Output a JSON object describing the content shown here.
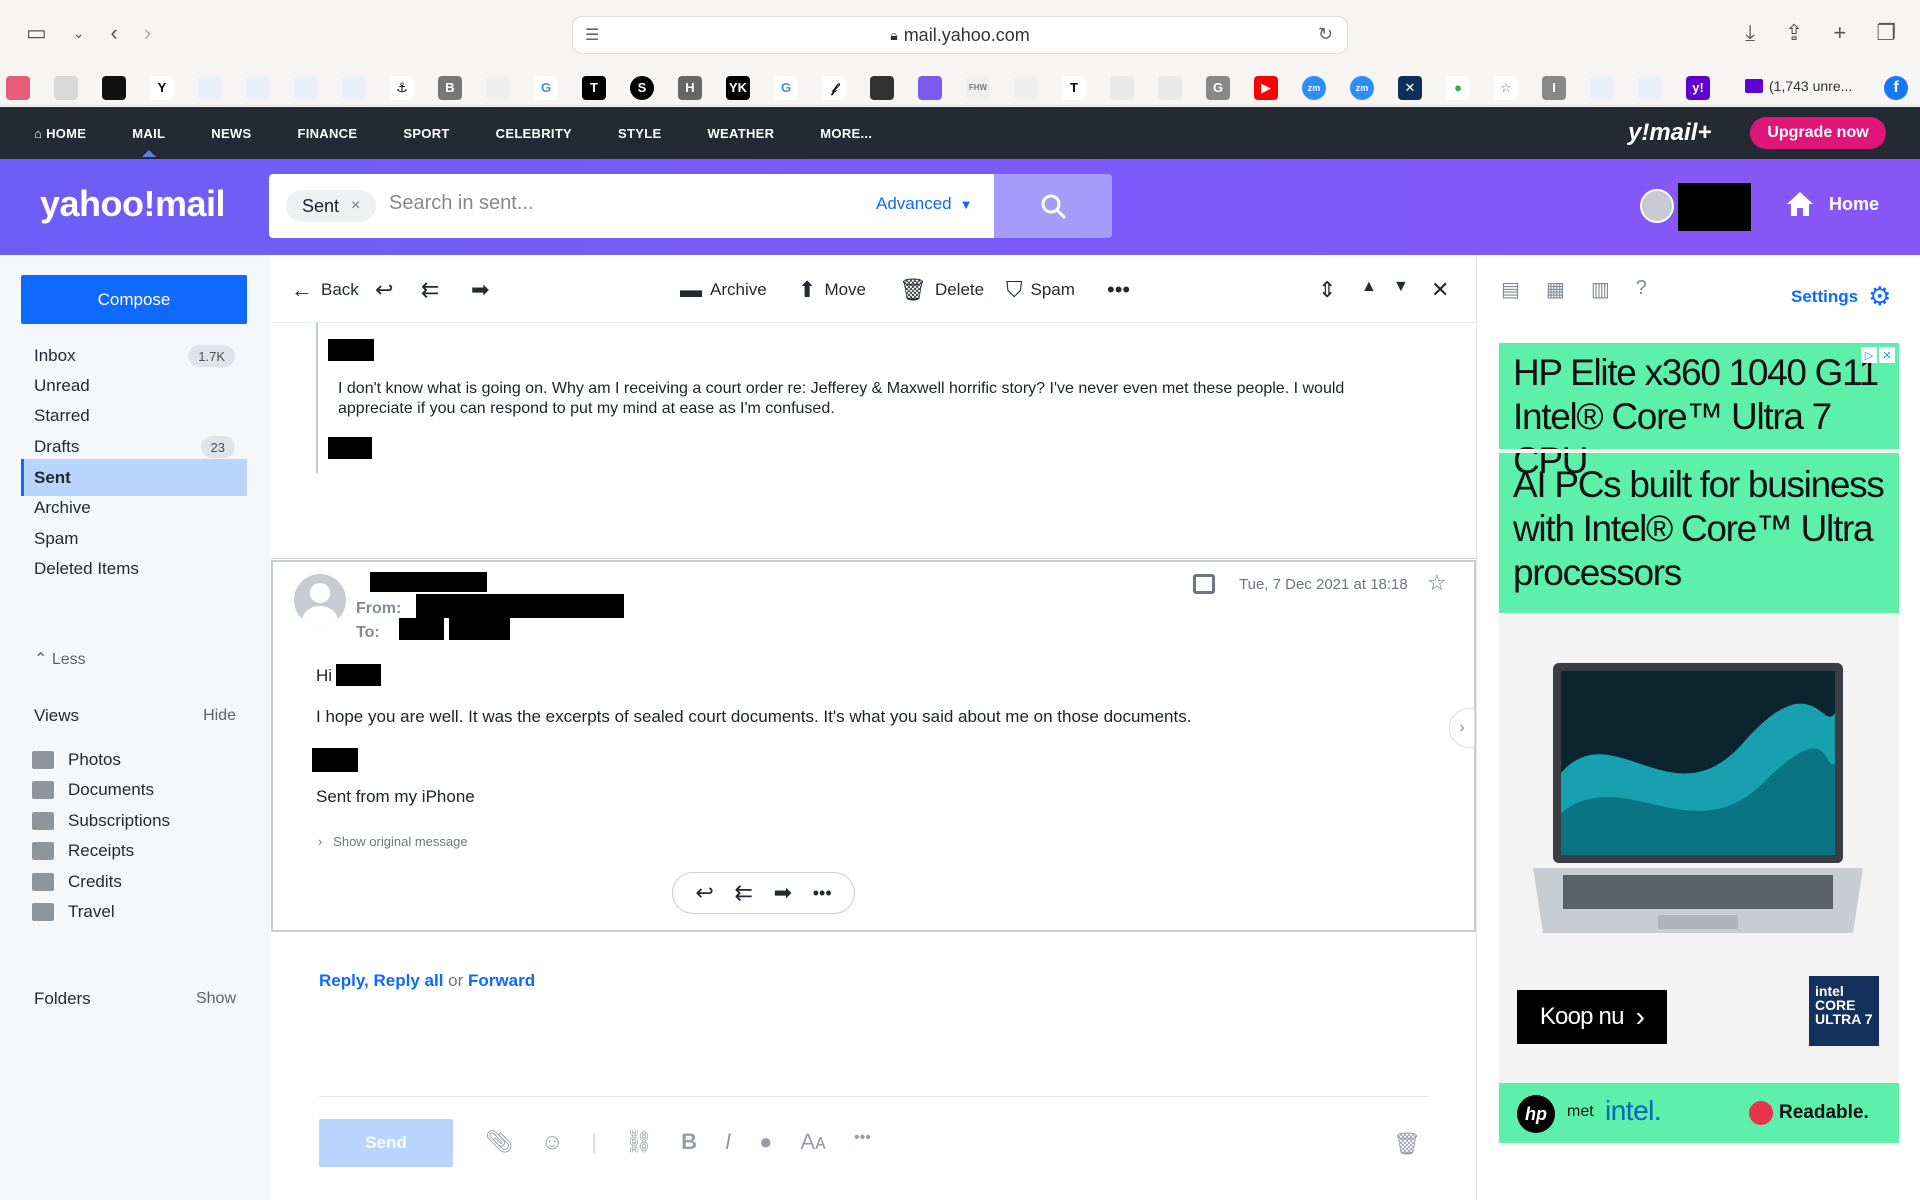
{
  "browser": {
    "url": "mail.yahoo.com",
    "mail_tab": "(1,743 unre..."
  },
  "nav": {
    "items": [
      "HOME",
      "MAIL",
      "NEWS",
      "FINANCE",
      "SPORT",
      "CELEBRITY",
      "STYLE",
      "WEATHER",
      "MORE..."
    ],
    "brand": "y!mail+",
    "upgrade": "Upgrade now"
  },
  "header": {
    "logo": "yahoo!mail",
    "chip": "Sent",
    "search_placeholder": "Search in sent...",
    "advanced": "Advanced",
    "home": "Home"
  },
  "sidebar": {
    "compose": "Compose",
    "folders": [
      {
        "label": "Inbox",
        "count": "1.7K"
      },
      {
        "label": "Unread",
        "count": ""
      },
      {
        "label": "Starred",
        "count": ""
      },
      {
        "label": "Drafts",
        "count": "23"
      },
      {
        "label": "Sent",
        "count": ""
      },
      {
        "label": "Archive",
        "count": ""
      },
      {
        "label": "Spam",
        "count": ""
      },
      {
        "label": "Deleted Items",
        "count": ""
      }
    ],
    "less": "Less",
    "views_title": "Views",
    "views_toggle": "Hide",
    "views": [
      "Photos",
      "Documents",
      "Subscriptions",
      "Receipts",
      "Credits",
      "Travel"
    ],
    "folders_title": "Folders",
    "folders_toggle": "Show"
  },
  "toolbar": {
    "back": "Back",
    "archive": "Archive",
    "move": "Move",
    "delete": "Delete",
    "spam": "Spam"
  },
  "thread": {
    "quoted_text": "I don't know what is going on. Why am I receiving a court order re: Jefferey & Maxwell horrific story? I've never even met these people. I would appreciate if you can respond to put my mind at ease as I'm confused.",
    "message": {
      "from_label": "From:",
      "to_label": "To:",
      "date": "Tue, 7 Dec 2021 at 18:18",
      "greeting": "Hi",
      "body": "I hope you are well. It was the excerpts of sealed court documents. It's what you said about me on those documents.",
      "signature": "Sent from my iPhone",
      "show_original": "Show original message"
    }
  },
  "reply": {
    "reply": "Reply",
    "reply_all": "Reply all",
    "or": "or",
    "forward": "Forward",
    "send": "Send"
  },
  "right_panel": {
    "settings": "Settings"
  },
  "ad": {
    "headline": "HP Elite x360 1040 G11 Intel® Core™ Ultra 7 CPU",
    "subhead": "AI PCs built for business with Intel® Core™ Ultra processors",
    "cta": "Koop nu",
    "badge": "intel CORE ULTRA 7",
    "met": "met",
    "intel": "intel.",
    "readable": "Readable."
  }
}
